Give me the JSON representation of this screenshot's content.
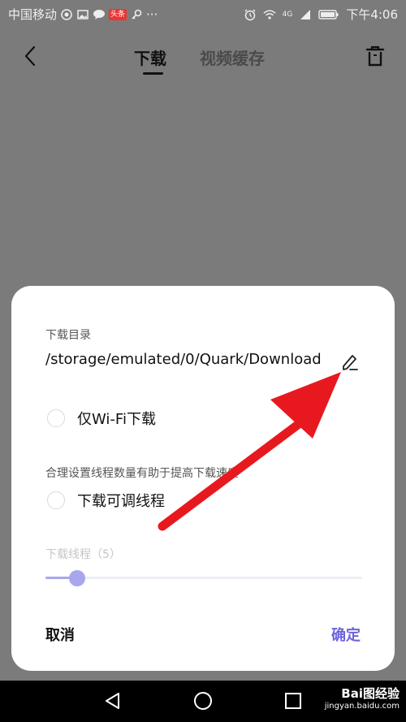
{
  "status_bar": {
    "carrier": "中国移动",
    "toutiao_badge": "头条",
    "more": "···",
    "network": "4G",
    "time": "下午4:06"
  },
  "nav": {
    "tabs": [
      {
        "label": "下载",
        "active": true
      },
      {
        "label": "视频缓存",
        "active": false
      }
    ]
  },
  "dialog": {
    "dir_label": "下载目录",
    "dir_path": "/storage/emulated/0/Quark/Download",
    "wifi_only_label": "仅Wi-Fi下载",
    "wifi_only_checked": false,
    "hint": "合理设置线程数量有助于提高下载速度",
    "adjustable_threads_label": "下载可调线程",
    "adjustable_threads_checked": false,
    "threads_label": "下载线程（5）",
    "threads_value": 5,
    "threads_slider_fraction": 0.1,
    "cancel_label": "取消",
    "confirm_label": "确定"
  },
  "watermark": {
    "brand": "Bai图经验",
    "url": "jingyan.baidu.com"
  },
  "colors": {
    "accent": "#6b63dc",
    "slider": "#a9a6ee",
    "annotation": "#e8191e",
    "overlay": "#7b7b7b"
  }
}
